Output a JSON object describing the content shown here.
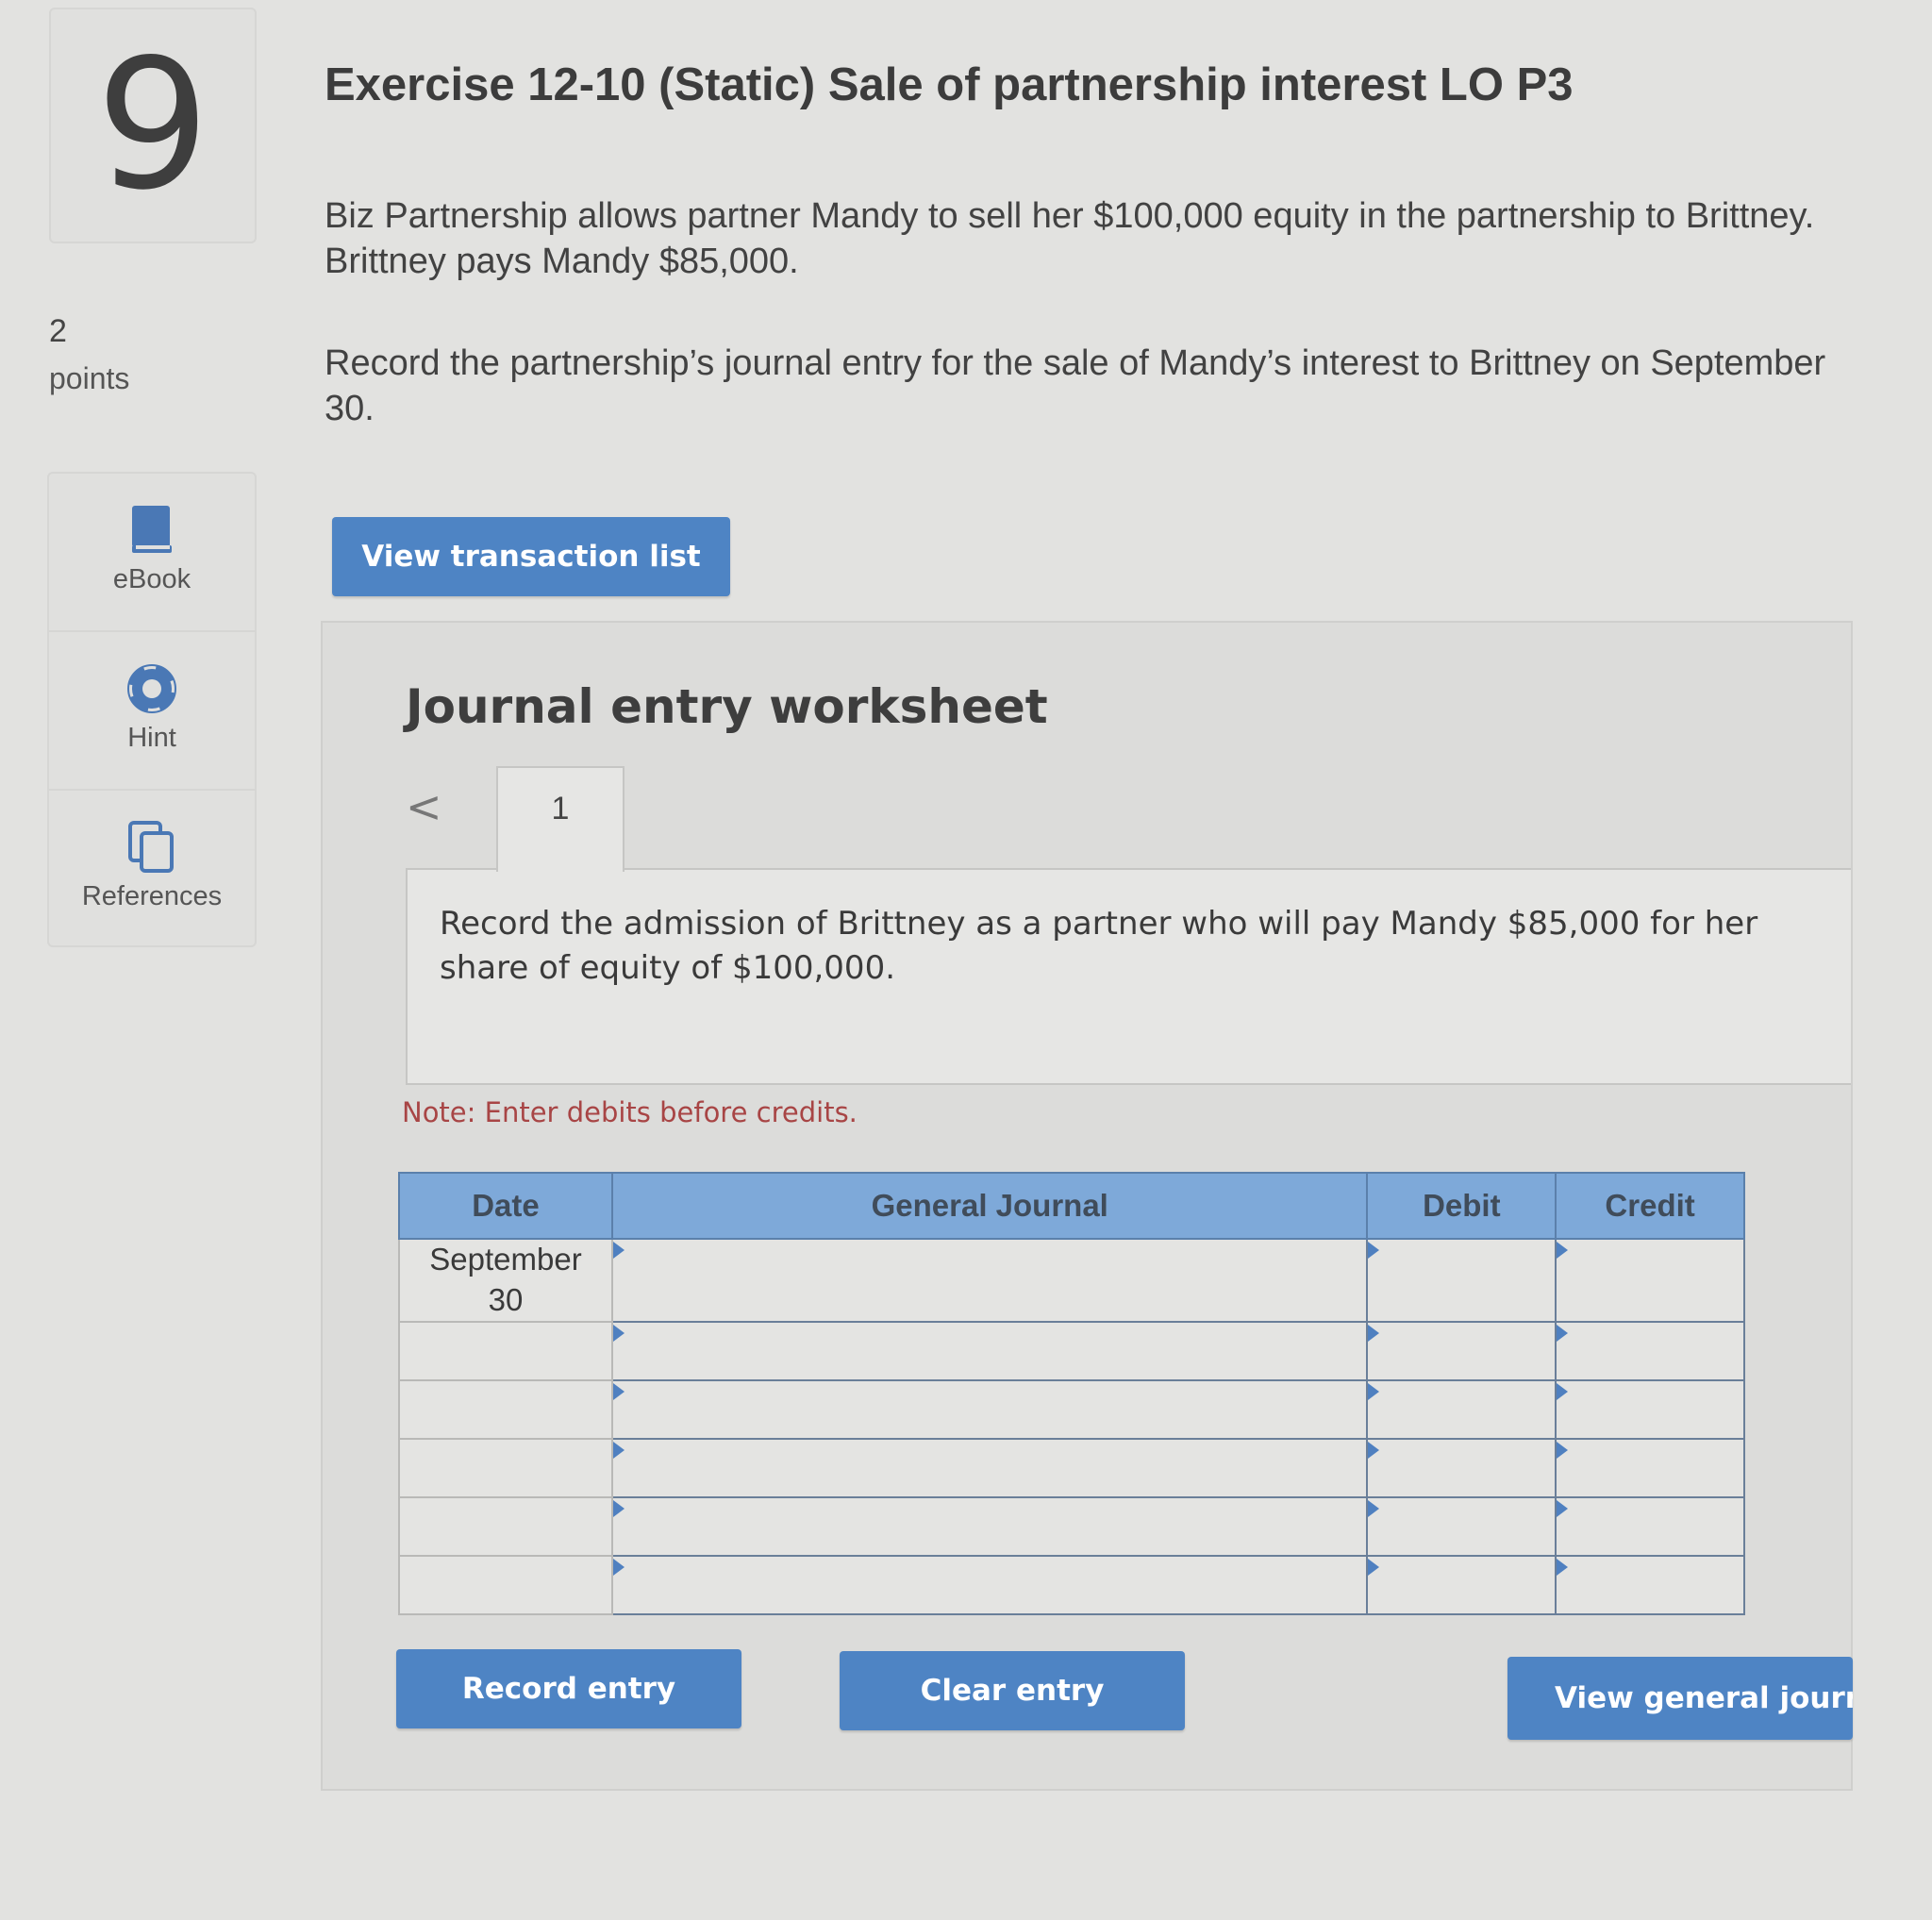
{
  "question": {
    "number": "9",
    "points_value": "2",
    "points_label": "points"
  },
  "tools": [
    {
      "label": "eBook",
      "icon": "book-icon"
    },
    {
      "label": "Hint",
      "icon": "lifebuoy-icon"
    },
    {
      "label": "References",
      "icon": "documents-icon"
    }
  ],
  "exercise": {
    "title": "Exercise 12-10 (Static) Sale of partnership interest LO P3",
    "paragraph1": "Biz Partnership allows partner Mandy to sell her $100,000 equity in the partnership to Brittney. Brittney pays Mandy $85,000.",
    "paragraph2": "Record the partnership’s journal entry for the sale of Mandy’s interest to Brittney on September 30.",
    "view_transaction_label": "View transaction list"
  },
  "worksheet": {
    "title": "Journal entry worksheet",
    "prev_symbol": "<",
    "tab_label": "1",
    "instruction": "Record the admission of Brittney as a partner who will pay Mandy $85,000 for her share of equity of $100,000.",
    "note": "Note: Enter debits before credits.",
    "columns": {
      "date": "Date",
      "journal": "General Journal",
      "debit": "Debit",
      "credit": "Credit"
    },
    "rows": [
      {
        "date": "September 30",
        "journal": "",
        "debit": "",
        "credit": ""
      },
      {
        "date": "",
        "journal": "",
        "debit": "",
        "credit": ""
      },
      {
        "date": "",
        "journal": "",
        "debit": "",
        "credit": ""
      },
      {
        "date": "",
        "journal": "",
        "debit": "",
        "credit": ""
      },
      {
        "date": "",
        "journal": "",
        "debit": "",
        "credit": ""
      },
      {
        "date": "",
        "journal": "",
        "debit": "",
        "credit": ""
      }
    ],
    "record_label": "Record entry",
    "clear_label": "Clear entry",
    "general_journal_label": "View general journal"
  },
  "colors": {
    "button_blue": "#4e84c4",
    "header_blue": "#7ea9d9",
    "note_red": "#a84545"
  }
}
